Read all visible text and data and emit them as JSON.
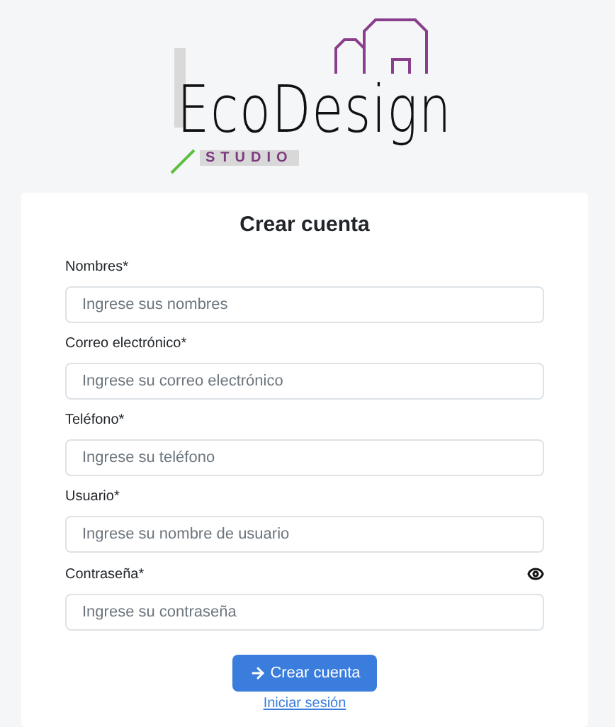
{
  "logo": {
    "name": "EcoDesign",
    "tagline": "STUDIO"
  },
  "form": {
    "title": "Crear cuenta",
    "fields": [
      {
        "label": "Nombres*",
        "placeholder": "Ingrese sus nombres",
        "kind": "text"
      },
      {
        "label": "Correo electrónico*",
        "placeholder": "Ingrese su correo electrónico",
        "kind": "text"
      },
      {
        "label": "Teléfono*",
        "placeholder": "Ingrese su teléfono",
        "kind": "text"
      },
      {
        "label": "Usuario*",
        "placeholder": "Ingrese su nombre de usuario",
        "kind": "text"
      },
      {
        "label": "Contraseña*",
        "placeholder": "Ingrese su contraseña",
        "kind": "password"
      }
    ],
    "submit": "Crear cuenta",
    "login_link": "Iniciar sesión"
  }
}
